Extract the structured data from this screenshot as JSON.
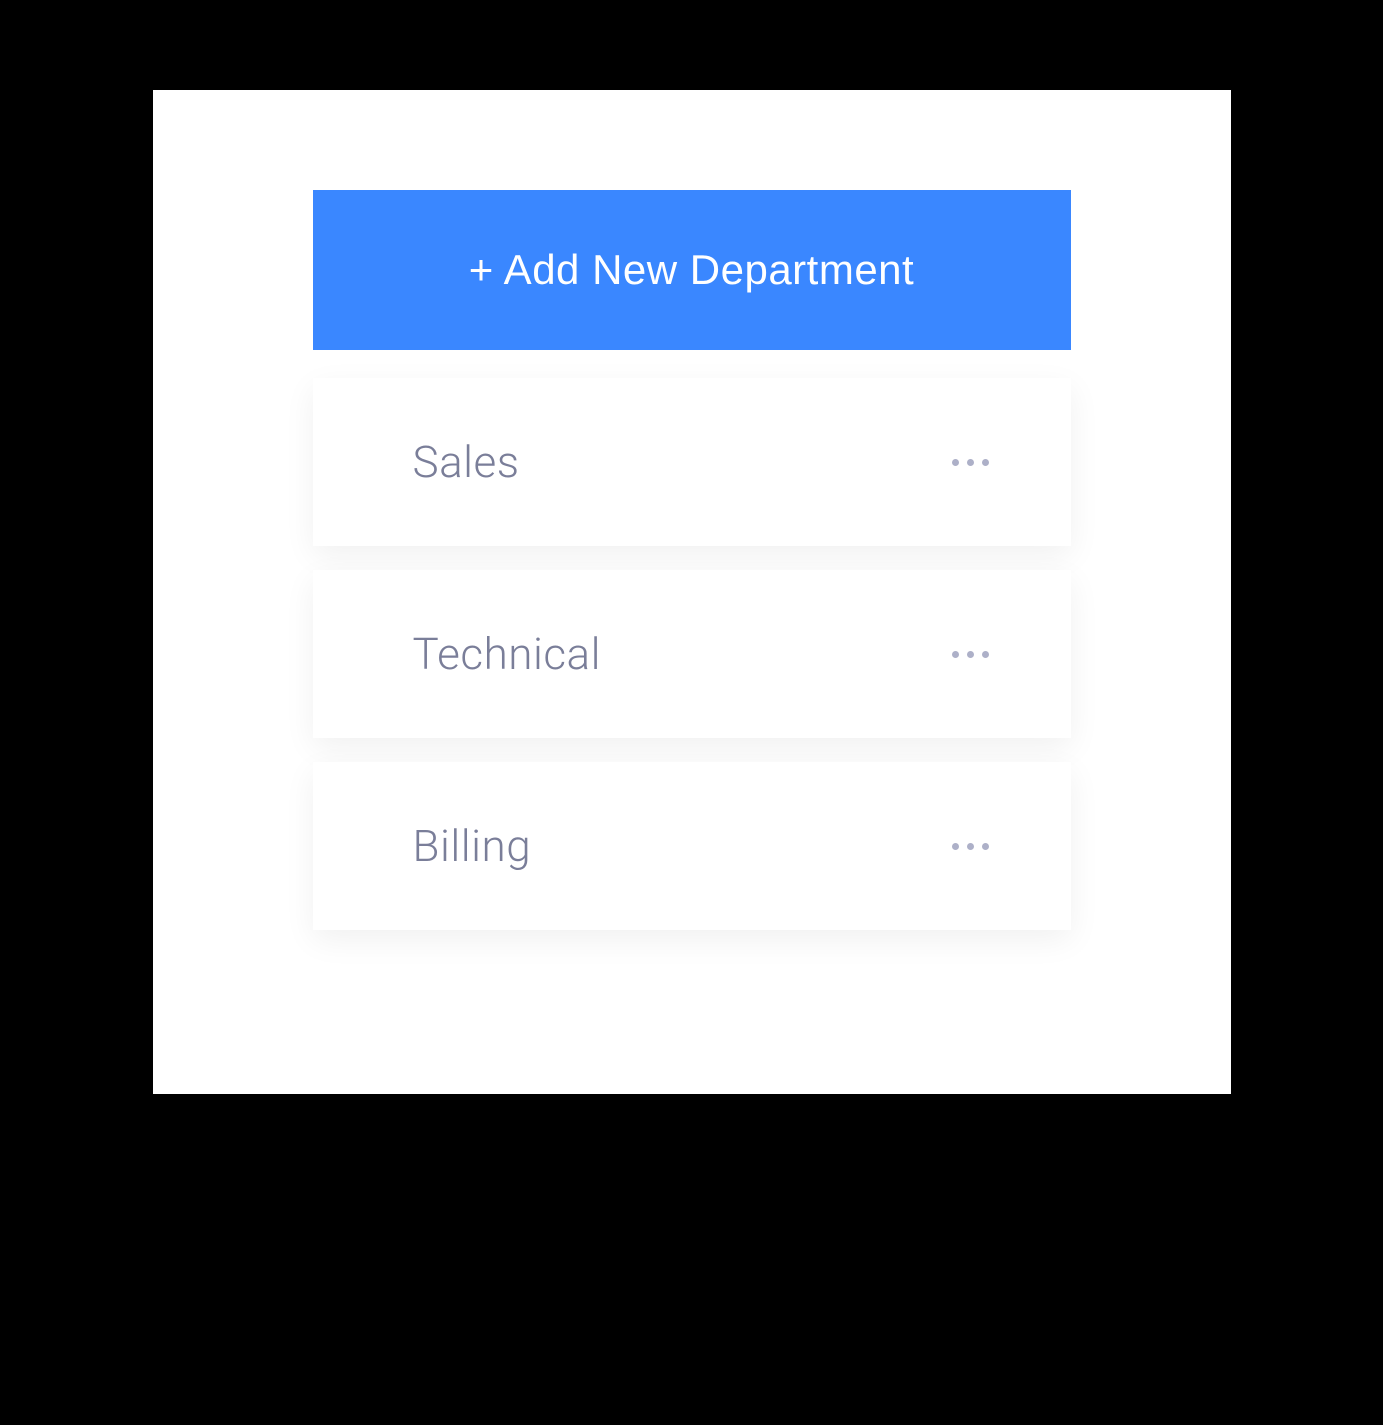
{
  "add_button": {
    "label": "+ Add New Department"
  },
  "departments": [
    {
      "name": "Sales"
    },
    {
      "name": "Technical"
    },
    {
      "name": "Billing"
    }
  ],
  "colors": {
    "primary": "#3a87ff",
    "text_muted": "#7a7e99",
    "icon_muted": "#adb0c8",
    "background": "#000000",
    "panel": "#ffffff"
  }
}
